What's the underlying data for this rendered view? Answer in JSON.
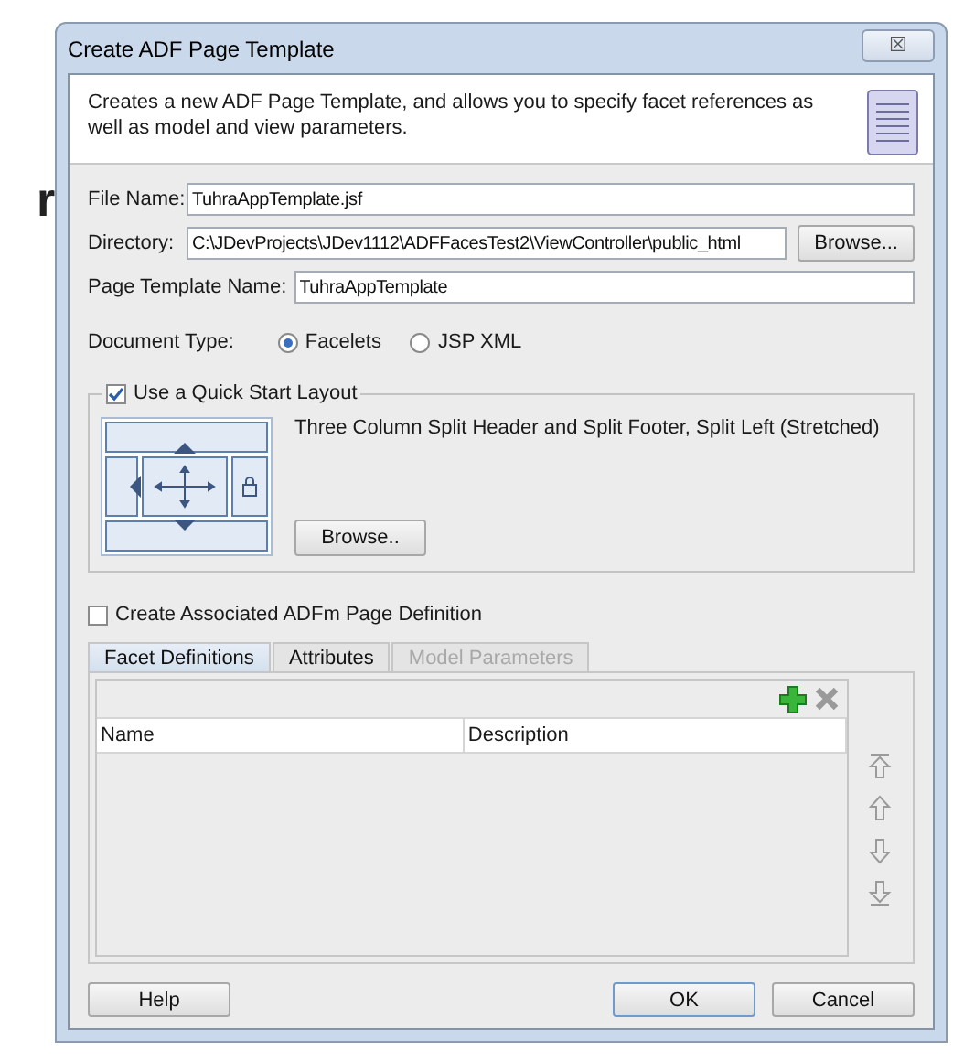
{
  "background_text": "r",
  "window": {
    "title": "Create ADF Page Template",
    "close_label": "☒"
  },
  "header": {
    "description": "Creates a new ADF Page Template, and allows you to specify facet references as well as model and view parameters."
  },
  "fields": [
    {
      "label": "File Name:",
      "value": "TuhraAppTemplate.jsf"
    },
    {
      "label": "Directory:",
      "value": "C:\\JDevProjects\\JDev1112\\ADFFacesTest2\\ViewController\\public_html",
      "button": "Browse..."
    },
    {
      "label": "Page Template Name:",
      "value": "TuhraAppTemplate"
    }
  ],
  "document_type": {
    "label": "Document Type:",
    "options": [
      {
        "label": "Facelets",
        "selected": true
      },
      {
        "label": "JSP XML",
        "selected": false
      }
    ]
  },
  "quick_start": {
    "label": "Use a Quick Start Layout",
    "checked": true,
    "layout_name": "Three Column Split Header and Split Footer, Split Left (Stretched)",
    "browse": "Browse.."
  },
  "adfm_checkbox": {
    "label": "Create Associated ADFm Page Definition",
    "checked": false
  },
  "tabs": [
    {
      "label": "Facet Definitions",
      "selected": true,
      "disabled": false
    },
    {
      "label": "Attributes",
      "selected": false,
      "disabled": false
    },
    {
      "label": "Model Parameters",
      "selected": false,
      "disabled": true
    }
  ],
  "table": {
    "columns": [
      "Name",
      "Description"
    ]
  },
  "buttons": {
    "help": "Help",
    "ok": "OK",
    "cancel": "Cancel"
  }
}
